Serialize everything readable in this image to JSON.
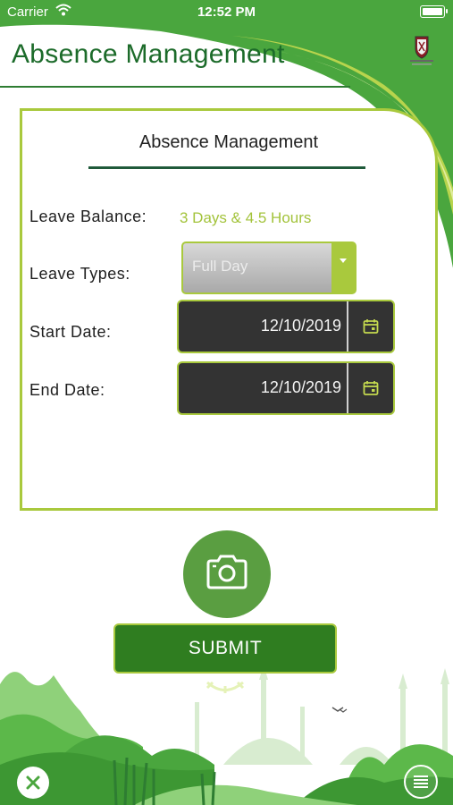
{
  "status_bar": {
    "carrier": "Carrier",
    "time": "12:52 PM"
  },
  "header": {
    "title": "Absence Management",
    "logo_icon": "university-crest-icon"
  },
  "form": {
    "title": "Absence Management",
    "leave_balance": {
      "label": "Leave Balance:",
      "value": "3 Days & 4.5 Hours"
    },
    "leave_types": {
      "label": "Leave Types:",
      "selected": "Full Day"
    },
    "start_date": {
      "label": "Start Date:",
      "value": "12/10/2019"
    },
    "end_date": {
      "label": "End Date:",
      "value": "12/10/2019"
    }
  },
  "actions": {
    "camera_icon": "camera-icon",
    "submit_label": "SUBMIT",
    "close_icon": "close-icon",
    "menu_icon": "menu-icon"
  },
  "colors": {
    "primary_green": "#4aa63e",
    "dark_green": "#1c6b2a",
    "accent_lime": "#a9c93d",
    "field_dark": "#333333",
    "submit_green": "#2f7d20"
  }
}
